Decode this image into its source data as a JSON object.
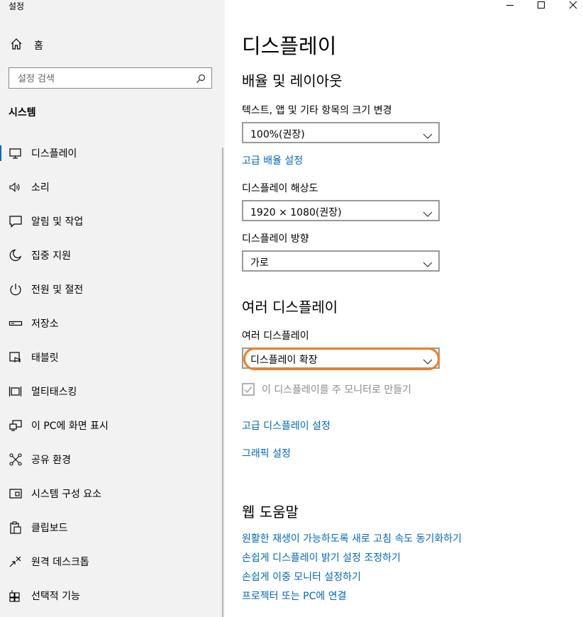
{
  "window": {
    "title": "설정"
  },
  "sidebar": {
    "home_label": "홈",
    "search_placeholder": "설정 검색",
    "section_title": "시스템",
    "items": [
      {
        "label": "디스플레이",
        "icon": "monitor-icon",
        "active": true
      },
      {
        "label": "소리",
        "icon": "speaker-icon"
      },
      {
        "label": "알림 및 작업",
        "icon": "notification-icon"
      },
      {
        "label": "집중 지원",
        "icon": "moon-icon"
      },
      {
        "label": "전원 및 절전",
        "icon": "power-icon"
      },
      {
        "label": "저장소",
        "icon": "storage-icon"
      },
      {
        "label": "태블릿",
        "icon": "tablet-icon"
      },
      {
        "label": "멀티태스킹",
        "icon": "multitasking-icon"
      },
      {
        "label": "이 PC에 화면 표시",
        "icon": "project-icon"
      },
      {
        "label": "공유 환경",
        "icon": "share-icon"
      },
      {
        "label": "시스템 구성 요소",
        "icon": "components-icon"
      },
      {
        "label": "클립보드",
        "icon": "clipboard-icon"
      },
      {
        "label": "원격 데스크톱",
        "icon": "remote-desktop-icon"
      },
      {
        "label": "선택적 기능",
        "icon": "optional-features-icon"
      }
    ]
  },
  "main": {
    "page_title": "디스플레이",
    "scale_section": {
      "heading": "배율 및 레이아웃",
      "text_size_label": "텍스트, 앱 및 기타 항목의 크기 변경",
      "text_size_value": "100%(권장)",
      "advanced_scaling_link": "고급 배율 설정",
      "resolution_label": "디스플레이 해상도",
      "resolution_value": "1920 × 1080(권장)",
      "orientation_label": "디스플레이 방향",
      "orientation_value": "가로"
    },
    "multi_display": {
      "heading": "여러 디스플레이",
      "label": "여러 디스플레이",
      "value": "디스플레이 확장",
      "main_monitor_checkbox_label": "이 디스플레이를 주 모니터로 만들기",
      "main_monitor_checked": true,
      "advanced_display_link": "고급 디스플레이 설정",
      "graphics_link": "그래픽 설정"
    },
    "web_help": {
      "heading": "웹 도움말",
      "links": [
        "원활한 재생이 가능하도록 새로 고침 속도 동기화하기",
        "손쉽게 디스플레이 밝기 설정 조정하기",
        "손쉽게 이중 모니터 설정하기",
        "프로젝터 또는 PC에 연결"
      ]
    }
  },
  "colors": {
    "accent": "#0067b8",
    "highlight": "#f07c25",
    "sidebar_bg": "#f2f2f2"
  }
}
